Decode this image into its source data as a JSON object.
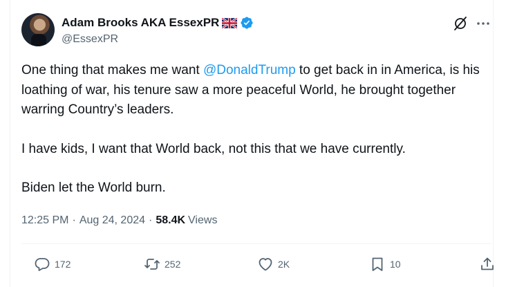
{
  "author": {
    "name": "Adam Brooks AKA EssexPR",
    "handle": "@EssexPR",
    "flag": "uk-flag-icon",
    "verified": "verified-badge-icon"
  },
  "tweet": {
    "para1_pre": "One thing that makes me want ",
    "mention": "@DonaldTrump",
    "para1_post": " to get back in in America, is his loathing of war, his tenure saw a more peaceful World, he brought together warring Country’s leaders.",
    "para2": "I have kids, I want that World back, not this that we have currently.",
    "para3": "Biden let the World burn."
  },
  "meta": {
    "time": "12:25 PM",
    "date": "Aug 24, 2024",
    "separator": "·",
    "views_count": "58.4K",
    "views_label": "Views"
  },
  "actions": {
    "replies": "172",
    "reposts": "252",
    "likes": "2K",
    "bookmarks": "10"
  },
  "colors": {
    "accent": "#1d9bf0",
    "text": "#0f1419",
    "muted": "#536471",
    "border": "#eff3f4"
  }
}
